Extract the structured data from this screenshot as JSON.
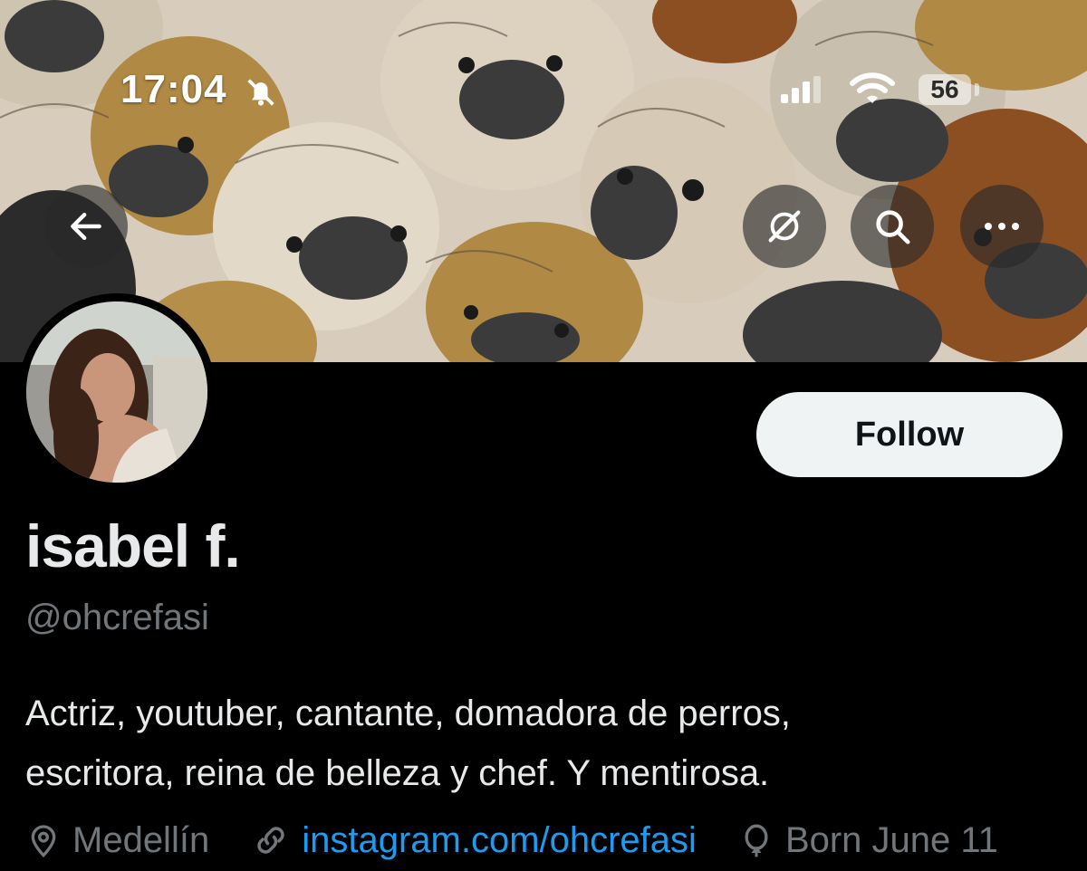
{
  "status_bar": {
    "time": "17:04",
    "battery": "56",
    "icons": [
      "bell-muted-icon",
      "cellular-signal-icon",
      "wifi-icon",
      "battery-icon"
    ]
  },
  "header": {
    "back_icon": "arrow-left-icon",
    "grok_icon": "grok-icon",
    "search_icon": "search-icon",
    "more_icon": "more-horizontal-icon"
  },
  "profile": {
    "follow_label": "Follow",
    "display_name": "isabel f.",
    "handle": "@ohcrefasi",
    "bio_line1": "Actriz, youtuber, cantante, domadora de perros,",
    "bio_line2": "escritora, reina de belleza y chef. Y mentirosa.",
    "location": "Medellín",
    "website": "instagram.com/ohcrefasi",
    "birthday": "Born June 11"
  },
  "colors": {
    "background": "#000000",
    "text_primary": "#e7e9ea",
    "text_secondary": "#71767b",
    "link": "#1d9bf0",
    "follow_button_bg": "#eff3f4"
  }
}
